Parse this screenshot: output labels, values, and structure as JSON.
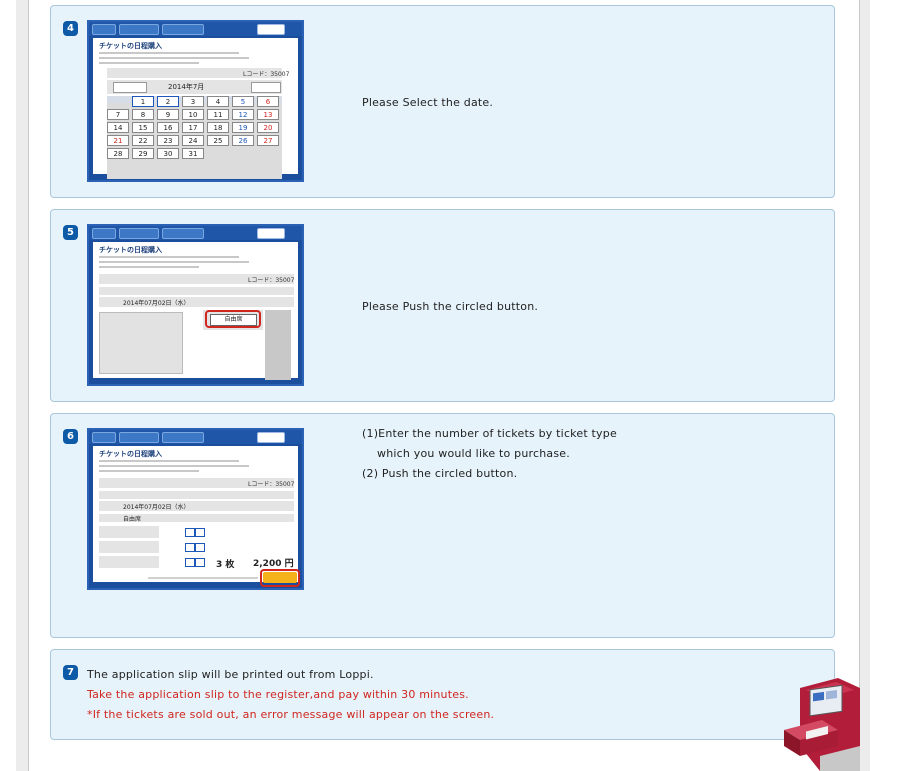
{
  "steps": [
    {
      "number": "4",
      "text": "Please Select the date."
    },
    {
      "number": "5",
      "text": "Please Push the circled button."
    },
    {
      "number": "6",
      "line1": "(1)Enter the number of tickets by ticket type",
      "line2": "which you would like to purchase.",
      "line3": "(2) Push the circled button."
    },
    {
      "number": "7",
      "line1": "The application slip will be printed out from Loppi.",
      "line2": "Take the application slip to the register,and pay within 30 minutes.",
      "line3": "*If the tickets are sold out, an error message will appear on the screen."
    }
  ],
  "screens": {
    "title": "チケットの日程購入",
    "month": "2014年7月",
    "lcode": "Lコード：35007",
    "date": "2014年07月02日（水）",
    "button_label": "自由席",
    "total_qty": "3 枚",
    "total_price": "2,200 円",
    "calendar": [
      [
        "",
        "1",
        "2",
        "3",
        "4",
        "5",
        "6"
      ],
      [
        "7",
        "8",
        "9",
        "10",
        "11",
        "12",
        "13"
      ],
      [
        "14",
        "15",
        "16",
        "17",
        "18",
        "19",
        "20"
      ],
      [
        "21",
        "22",
        "23",
        "24",
        "25",
        "26",
        "27"
      ],
      [
        "28",
        "29",
        "30",
        "31",
        "",
        "",
        ""
      ]
    ]
  },
  "colors": {
    "badge": "#0d5aa7",
    "panel": "#e6f3fb",
    "accent_red": "#d0261f"
  },
  "icons": {
    "kiosk": "loppi-kiosk-illustration"
  }
}
